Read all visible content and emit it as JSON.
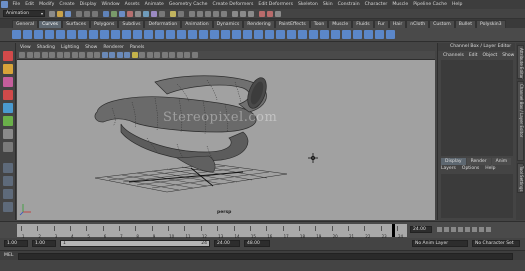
{
  "menubar": {
    "items": [
      "File",
      "Edit",
      "Modify",
      "Create",
      "Display",
      "Window",
      "Assets",
      "Animate",
      "Geometry Cache",
      "Create Deformers",
      "Edit Deformers",
      "Skeleton",
      "Skin",
      "Constrain",
      "Character",
      "Muscle",
      "Pipeline Cache",
      "Help"
    ]
  },
  "statusline": {
    "mode": "Animation"
  },
  "shelf": {
    "tabs": [
      "General",
      "Curves",
      "Surfaces",
      "Polygons",
      "Subdivs",
      "Deformation",
      "Animation",
      "Dynamics",
      "Rendering",
      "PaintEffects",
      "Toon",
      "Muscle",
      "Fluids",
      "Fur",
      "Hair",
      "nCloth",
      "Custom",
      "Bullet",
      "Polyskin3"
    ],
    "active_tab": "Curves"
  },
  "panel": {
    "menu": [
      "View",
      "Shading",
      "Lighting",
      "Show",
      "Renderer",
      "Panels"
    ]
  },
  "viewport": {
    "camera": "persp",
    "watermark": "Stereopixel.com",
    "background": "#a1a1a1"
  },
  "channel_box": {
    "title": "Channel Box / Layer Editor",
    "menu": [
      "Channels",
      "Edit",
      "Object",
      "Show"
    ]
  },
  "layer_editor": {
    "tabs": [
      "Display",
      "Render",
      "Anim"
    ],
    "active_tab": "Display",
    "menu": [
      "Layers",
      "Options",
      "Help"
    ]
  },
  "side_tabs": [
    "Attribute Editor",
    "Channel Box / Layer Editor",
    "Tool Settings"
  ],
  "timeline": {
    "ticks": [
      "1",
      "2",
      "3",
      "4",
      "5",
      "6",
      "7",
      "8",
      "9",
      "10",
      "11",
      "12",
      "13",
      "14",
      "15",
      "16",
      "17",
      "18",
      "19",
      "20",
      "21",
      "22",
      "23",
      "24"
    ],
    "current_frame": "24.00",
    "current_marker": "24"
  },
  "range": {
    "start_time": "1.00",
    "playback_start": "1.00",
    "slider_start": "1",
    "slider_end": "24",
    "playback_end": "24.00",
    "end_time": "48.00",
    "anim_layer": "No Anim Layer",
    "character_set": "No Character Set"
  },
  "command_line": {
    "label": "MEL"
  }
}
